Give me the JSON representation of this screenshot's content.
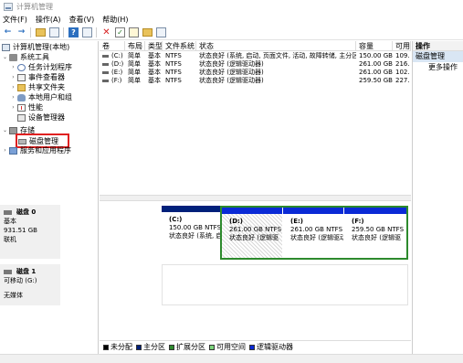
{
  "window": {
    "title": "计算机管理"
  },
  "menu": [
    "文件(F)",
    "操作(A)",
    "查看(V)",
    "帮助(H)"
  ],
  "toolbar": {
    "buttons": [
      "back-arrow-icon",
      "forward-arrow-icon",
      "up-folder-icon",
      "console-tree-icon",
      "properties-icon",
      "help-icon",
      "list-icon",
      "delete-icon",
      "check-icon",
      "open-icon",
      "new-icon"
    ]
  },
  "tree": {
    "root": "计算机管理(本地)",
    "system_tools": "系统工具",
    "task_scheduler": "任务计划程序",
    "event_viewer": "事件查看器",
    "shared_folders": "共享文件夹",
    "local_users": "本地用户和组",
    "performance": "性能",
    "device_manager": "设备管理器",
    "storage": "存储",
    "disk_management": "磁盘管理",
    "services_apps": "服务和应用程序"
  },
  "volume_table": {
    "headers": [
      "卷",
      "布局",
      "类型",
      "文件系统",
      "状态",
      "容量",
      "可用"
    ],
    "rows": [
      [
        "(C:)",
        "简单",
        "基本",
        "NTFS",
        "状态良好 (系统, 启动, 页面文件, 活动, 故障转储, 主分区)",
        "150.00 GB",
        "109."
      ],
      [
        "(D:)",
        "简单",
        "基本",
        "NTFS",
        "状态良好 (逻辑驱动器)",
        "261.00 GB",
        "216."
      ],
      [
        "(E:)",
        "简单",
        "基本",
        "NTFS",
        "状态良好 (逻辑驱动器)",
        "261.00 GB",
        "102."
      ],
      [
        "(F:)",
        "简单",
        "基本",
        "NTFS",
        "状态良好 (逻辑驱动器)",
        "259.50 GB",
        "227."
      ]
    ]
  },
  "disks": [
    {
      "name": "磁盘 0",
      "type": "基本",
      "size": "931.51 GB",
      "status": "联机",
      "partitions": [
        {
          "label": "(C:)",
          "size": "150.00 GB NTFS",
          "status": "状态良好 (系统, 启",
          "kind": "primary"
        },
        {
          "label": "(D:)",
          "size": "261.00 GB NTFS",
          "status": "状态良好 (逻辑驱",
          "kind": "logical"
        },
        {
          "label": "(E:)",
          "size": "261.00 GB NTFS",
          "status": "状态良好 (逻辑驱动",
          "kind": "logical"
        },
        {
          "label": "(F:)",
          "size": "259.50 GB NTFS",
          "status": "状态良好 (逻辑驱",
          "kind": "logical"
        }
      ]
    },
    {
      "name": "磁盘 1",
      "type": "可移动 (G:)",
      "status": "无媒体"
    }
  ],
  "legend": [
    {
      "label": "未分配",
      "color": "#000000"
    },
    {
      "label": "主分区",
      "color": "#00207a"
    },
    {
      "label": "扩展分区",
      "color": "#2d8a2d"
    },
    {
      "label": "可用空间",
      "color": "#7cd67c"
    },
    {
      "label": "逻辑驱动器",
      "color": "#0a2ad6"
    }
  ],
  "actions": {
    "header": "操作",
    "selected": "磁盘管理",
    "more": "更多操作"
  }
}
